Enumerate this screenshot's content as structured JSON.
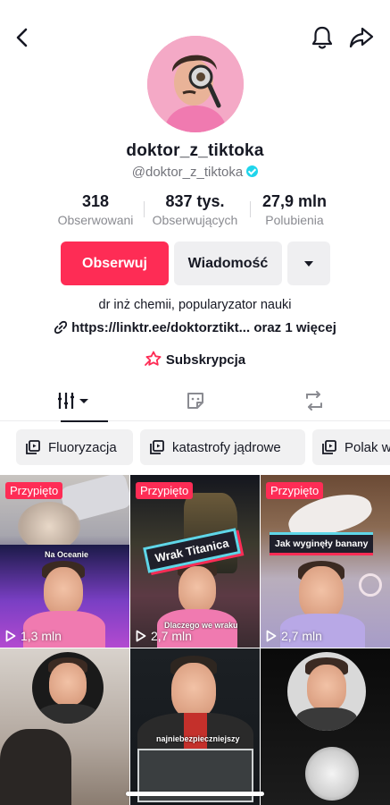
{
  "profile": {
    "username": "doktor_z_tiktoka",
    "handle": "@doktor_z_tiktoka",
    "bio": "dr inż chemii, popularyzator nauki",
    "link": "https://linktr.ee/doktorztikt...",
    "link_more": "oraz 1 więcej",
    "subscription_label": "Subskrypcja"
  },
  "stats": [
    {
      "value": "318",
      "label": "Obserwowani"
    },
    {
      "value": "837 tys.",
      "label": "Obserwujących"
    },
    {
      "value": "27,9 mln",
      "label": "Polubienia"
    }
  ],
  "actions": {
    "follow": "Obserwuj",
    "message": "Wiadomość"
  },
  "colors": {
    "accent": "#fe2c55",
    "verified": "#20d5ec"
  },
  "playlists": [
    {
      "name": "Fluoryzacja"
    },
    {
      "name": "katastrofy jądrowe"
    },
    {
      "name": "Polak w"
    }
  ],
  "videos": [
    {
      "pinned": "Przypięto",
      "views": "1,3 mln",
      "caption": "Na Oceanie"
    },
    {
      "pinned": "Przypięto",
      "views": "2,7 mln",
      "banner": "Wrak Titanica",
      "caption": "Dlaczego we wraku"
    },
    {
      "pinned": "Przypięto",
      "views": "2,7 mln",
      "banner": "Jak wyginęły banany"
    },
    {},
    {
      "caption": "najniebezpieczniejszy"
    },
    {}
  ]
}
